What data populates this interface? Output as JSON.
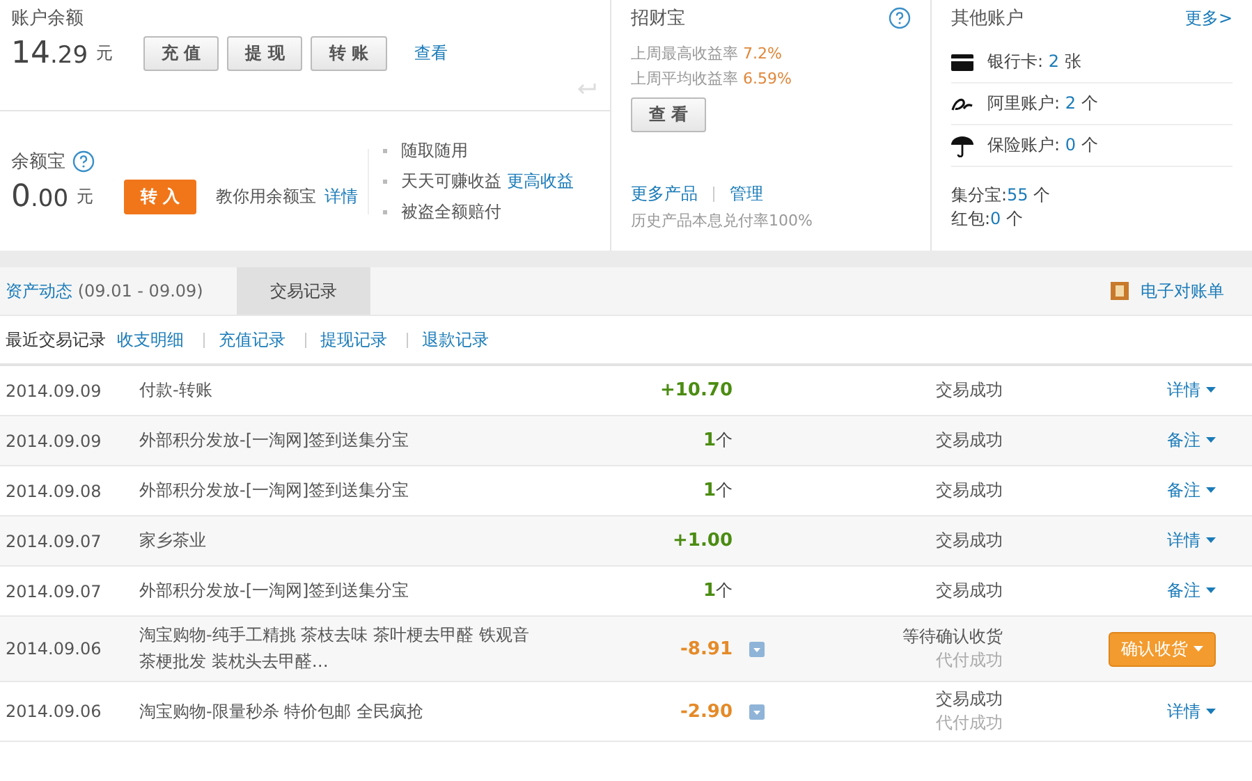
{
  "balance": {
    "title": "账户余额",
    "integer": "14",
    "decimal": ".29",
    "unit": "元",
    "buttons": [
      "充 值",
      "提 现",
      "转 账"
    ],
    "link": "查看"
  },
  "yuebao": {
    "title": "余额宝",
    "integer": "0",
    "decimal": ".00",
    "unit": "元",
    "button": "转 入",
    "hint": "教你用余额宝",
    "hint_link": "详情",
    "features": [
      {
        "text": "随取随用"
      },
      {
        "text": "天天可赚收益",
        "link": "更高收益"
      },
      {
        "text": "被盗全额赔付"
      }
    ]
  },
  "zhaocaibao": {
    "title": "招财宝",
    "rates": [
      {
        "label": "上周最高收益率",
        "value": "7.2%"
      },
      {
        "label": "上周平均收益率",
        "value": "6.59%"
      }
    ],
    "button": "查 看",
    "links": [
      "更多产品",
      "管理"
    ],
    "note": "历史产品本息兑付率100%"
  },
  "other_accounts": {
    "title": "其他账户",
    "more": "更多>",
    "items": [
      {
        "kind": "card",
        "label": "银行卡:",
        "count": "2",
        "unit": "张"
      },
      {
        "kind": "ali",
        "label": "阿里账户:",
        "count": "2",
        "unit": "个"
      },
      {
        "kind": "umbrella",
        "label": "保险账户:",
        "count": "0",
        "unit": "个"
      }
    ],
    "extras": [
      {
        "label": "集分宝:",
        "count": "55",
        "unit": "个"
      },
      {
        "label": "红包:",
        "count": "0",
        "unit": "个"
      }
    ]
  },
  "tabs": [
    {
      "label": "资产动态",
      "range": "(09.01 - 09.09)",
      "selected": false
    },
    {
      "label": "交易记录",
      "selected": true
    }
  ],
  "statement_link": "电子对账单",
  "subnav": [
    {
      "label": "最近交易记录",
      "selected": true
    },
    {
      "label": "收支明细",
      "selected": false
    },
    {
      "label": "充值记录",
      "selected": false
    },
    {
      "label": "提现记录",
      "selected": false
    },
    {
      "label": "退款记录",
      "selected": false
    }
  ],
  "rows": [
    {
      "date": "2014.09.09",
      "desc": [
        "付款-转账"
      ],
      "amount": "+10.70",
      "unit": "",
      "kind": "income",
      "toggle": false,
      "status": "交易成功",
      "action": {
        "label": "详情",
        "kind": "link"
      }
    },
    {
      "date": "2014.09.09",
      "desc": [
        "外部积分发放-[一淘网]签到送集分宝"
      ],
      "amount": "1",
      "unit": "个",
      "kind": "income",
      "toggle": false,
      "status": "交易成功",
      "action": {
        "label": "备注",
        "kind": "link"
      }
    },
    {
      "date": "2014.09.08",
      "desc": [
        "外部积分发放-[一淘网]签到送集分宝"
      ],
      "amount": "1",
      "unit": "个",
      "kind": "income",
      "toggle": false,
      "status": "交易成功",
      "action": {
        "label": "备注",
        "kind": "link"
      }
    },
    {
      "date": "2014.09.07",
      "desc": [
        "家乡茶业"
      ],
      "amount": "+1.00",
      "unit": "",
      "kind": "income",
      "toggle": false,
      "status": "交易成功",
      "action": {
        "label": "详情",
        "kind": "link"
      }
    },
    {
      "date": "2014.09.07",
      "desc": [
        "外部积分发放-[一淘网]签到送集分宝"
      ],
      "amount": "1",
      "unit": "个",
      "kind": "income",
      "toggle": false,
      "status": "交易成功",
      "action": {
        "label": "备注",
        "kind": "link"
      }
    },
    {
      "date": "2014.09.06",
      "desc": [
        "淘宝购物-纯手工精挑 茶枝去味 茶叶梗去甲醛 铁观音",
        "茶梗批发 装枕头去甲醛…"
      ],
      "amount": "-8.91",
      "unit": "",
      "kind": "expense",
      "toggle": true,
      "status": "等待确认收货",
      "substatus": "代付成功",
      "action": {
        "label": "确认收货",
        "kind": "button"
      }
    },
    {
      "date": "2014.09.06",
      "desc": [
        "淘宝购物-限量秒杀 特价包邮 全民疯抢"
      ],
      "amount": "-2.90",
      "unit": "",
      "kind": "expense",
      "toggle": true,
      "status": "交易成功",
      "substatus": "代付成功",
      "action": {
        "label": "详情",
        "kind": "link"
      }
    }
  ]
}
